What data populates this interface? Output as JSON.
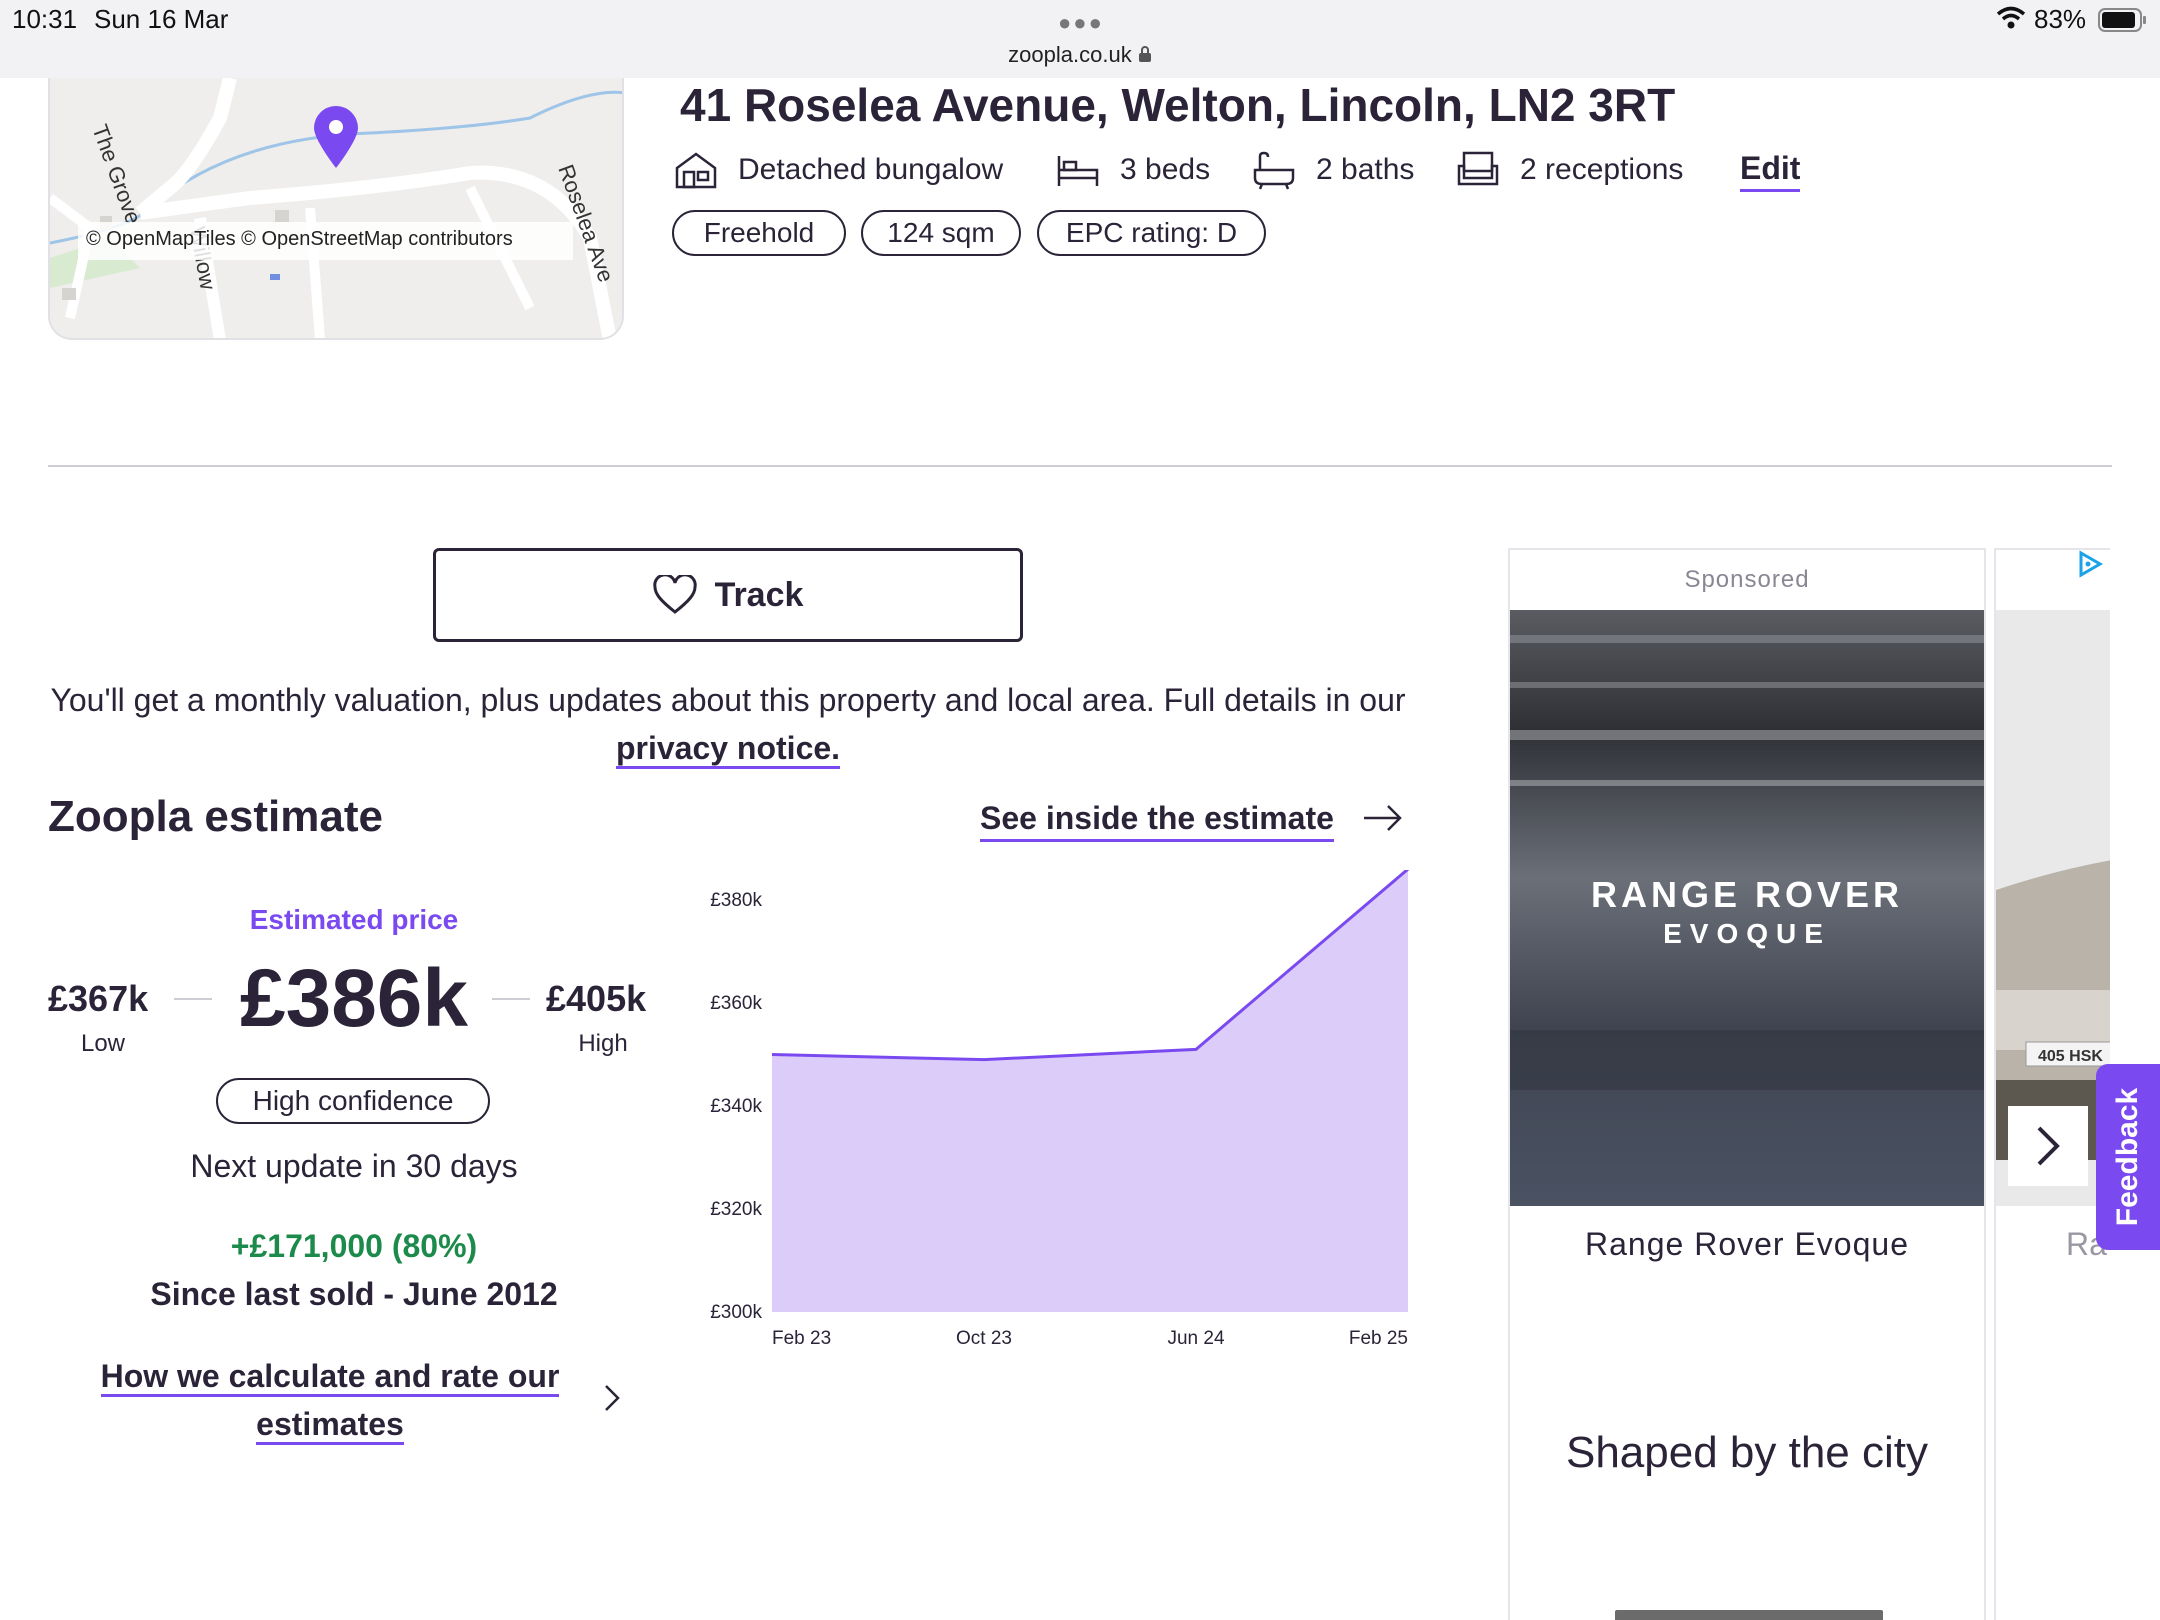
{
  "status_bar": {
    "time": "10:31",
    "date": "Sun 16 Mar",
    "url": "zoopla.co.uk",
    "battery": "83%"
  },
  "map": {
    "credit": "© OpenMapTiles © OpenStreetMap contributors",
    "streets": [
      "The Grove",
      "Willow",
      "Roselea Ave"
    ],
    "pin_color": "#7a4af0"
  },
  "property": {
    "address": "41 Roselea Avenue, Welton, Lincoln, LN2 3RT",
    "features": [
      {
        "icon": "house-icon",
        "label": "Detached bungalow"
      },
      {
        "icon": "bed-icon",
        "label": "3  beds"
      },
      {
        "icon": "bath-icon",
        "label": "2  baths"
      },
      {
        "icon": "sofa-icon",
        "label": "2  receptions"
      }
    ],
    "edit_label": "Edit",
    "tags": [
      "Freehold",
      "124 sqm",
      "EPC rating: D"
    ]
  },
  "track": {
    "button_label": "Track",
    "info_text": "You'll get a monthly valuation, plus updates about this property and local area. Full details in our ",
    "privacy_link": "privacy notice."
  },
  "estimate": {
    "title": "Zoopla estimate",
    "see_inside": "See inside the estimate",
    "estimated_label": "Estimated price",
    "value": "£386k",
    "low_value": "£367k",
    "low_label": "Low",
    "high_value": "£405k",
    "high_label": "High",
    "confidence": "High confidence",
    "next_update": "Next update in 30 days",
    "change": "+£171,000 (80%)",
    "since_sold": "Since last sold - June 2012",
    "how_calc": "How we calculate and rate our estimates"
  },
  "chart_data": {
    "type": "area",
    "title": "",
    "xlabel": "",
    "ylabel": "",
    "x_ticks": [
      "Feb 23",
      "Oct 23",
      "Jun 24",
      "Feb 25"
    ],
    "y_ticks": [
      "£300k",
      "£320k",
      "£340k",
      "£360k",
      "£380k"
    ],
    "ylim": [
      300,
      380
    ],
    "series": [
      {
        "x": [
          "Feb 23",
          "Oct 23",
          "Jun 24",
          "Feb 25"
        ],
        "values": [
          350,
          349,
          351,
          386
        ]
      }
    ],
    "line_color": "#7a4af0",
    "fill_color": "#dcccfa",
    "grid": false
  },
  "ad": {
    "sponsored": "Sponsored",
    "brand_line1": "RANGE ROVER",
    "brand_line2": "EVOQUE",
    "name": "Range Rover Evoque",
    "tagline": "Shaped by the city",
    "plate": "405 HSK",
    "next_name": "Ra"
  },
  "feedback_label": "Feedback"
}
